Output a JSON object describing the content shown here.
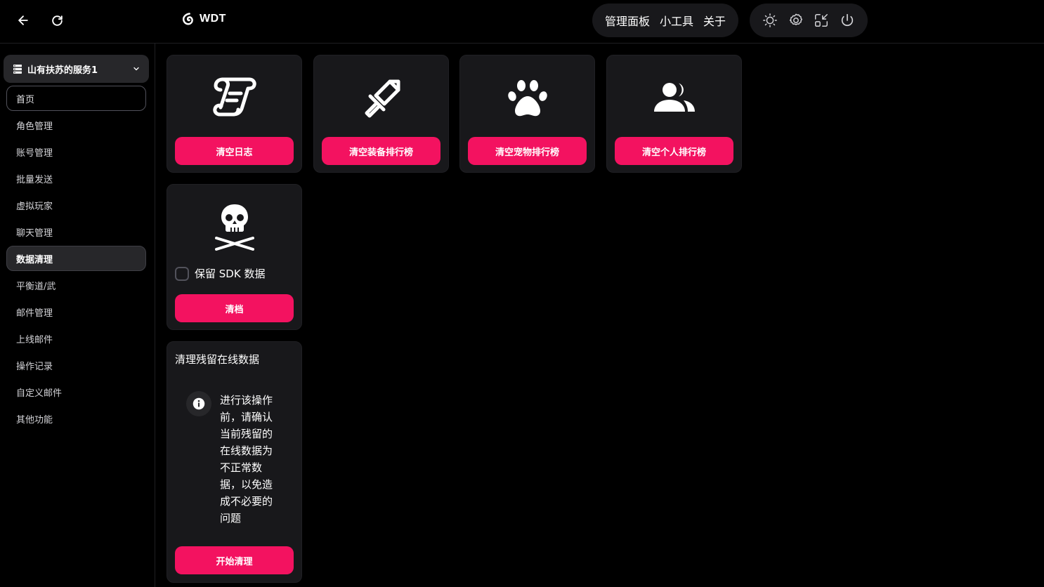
{
  "header": {
    "brand": "WDT",
    "nav": [
      "管理面板",
      "小工具",
      "关于"
    ]
  },
  "sidebar": {
    "server": "山有扶苏的服务1",
    "items": [
      {
        "label": "首页",
        "state": "outlined"
      },
      {
        "label": "角色管理",
        "state": ""
      },
      {
        "label": "账号管理",
        "state": ""
      },
      {
        "label": "批量发送",
        "state": ""
      },
      {
        "label": "虚拟玩家",
        "state": ""
      },
      {
        "label": "聊天管理",
        "state": ""
      },
      {
        "label": "数据清理",
        "state": "active"
      },
      {
        "label": "平衡道/武",
        "state": ""
      },
      {
        "label": "邮件管理",
        "state": ""
      },
      {
        "label": "上线邮件",
        "state": ""
      },
      {
        "label": "操作记录",
        "state": ""
      },
      {
        "label": "自定义邮件",
        "state": ""
      },
      {
        "label": "其他功能",
        "state": ""
      }
    ]
  },
  "cards": {
    "clear_log": "清空日志",
    "clear_equip_rank": "清空装备排行榜",
    "clear_pet_rank": "清空宠物排行榜",
    "clear_personal_rank": "清空个人排行榜",
    "keep_sdk_label": "保留 SDK 数据",
    "wipe": "清档",
    "online_title": "清理残留在线数据",
    "online_info": "进行该操作前，请确认当前残留的在线数据为不正常数据，以免造成不必要的问题",
    "start_clean": "开始清理"
  },
  "colors": {
    "accent": "#f31260",
    "card_bg": "#18181b",
    "page_bg": "#000000"
  }
}
